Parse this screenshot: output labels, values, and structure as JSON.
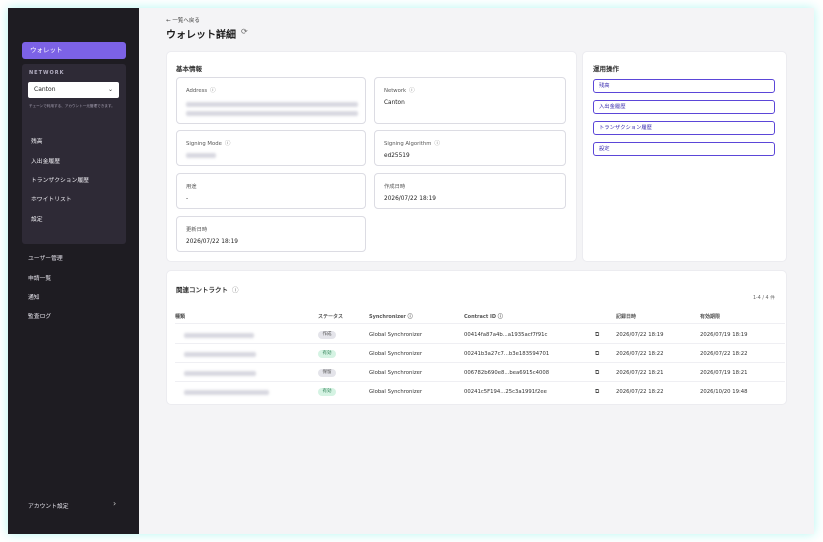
{
  "sidebar": {
    "active_item": "ウォレット",
    "network_label": "NETWORK",
    "network_value": "Canton",
    "network_hint": "チェーンで利用する、アカウント一元管理できます。",
    "network_items": [
      "残高",
      "入出金履歴",
      "トランザクション履歴",
      "ホワイトリスト",
      "設定"
    ],
    "links": [
      "ユーザー管理",
      "申請一覧",
      "通知",
      "監査ログ"
    ],
    "footer": "アカウント設定"
  },
  "main": {
    "back": "← 一覧へ戻る",
    "title": "ウォレット詳細",
    "basic_info": {
      "title": "基本情報",
      "address_label": "Address",
      "network_label": "Network",
      "network_value": "Canton",
      "signing_mode_label": "Signing Mode",
      "signing_algorithm_label": "Signing Algorithm",
      "signing_algorithm_value": "ed25519",
      "purpose_label": "用途",
      "purpose_value": "-",
      "created_label": "作成日時",
      "created_value": "2026/07/22 18:19",
      "updated_label": "更新日時",
      "updated_value": "2026/07/22 18:19"
    },
    "operations": {
      "title": "運用操作",
      "buttons": [
        "残高",
        "入出金履歴",
        "トランザクション履歴",
        "設定"
      ]
    },
    "contracts": {
      "title": "関連コントラクト",
      "count": "1-4 / 4 件",
      "headers": [
        "種類",
        "ステータス",
        "Synchronizer",
        "Contract ID",
        "",
        "記録日時",
        "有効期限"
      ],
      "rows": [
        {
          "status": "作成",
          "sync": "Global Synchronizer",
          "cid": "00414fa87a4b...a1935acf7f91c",
          "recorded": "2026/07/22 18:19",
          "expiry": "2026/07/19 18:19"
        },
        {
          "status": "有効",
          "sync": "Global Synchronizer",
          "cid": "00241b3a27c7...b3e183594701",
          "recorded": "2026/07/22 18:22",
          "expiry": "2026/07/22 18:22"
        },
        {
          "status": "保留",
          "sync": "Global Synchronizer",
          "cid": "006782b690e8...bea6915c4008",
          "recorded": "2026/07/22 18:21",
          "expiry": "2026/07/19 18:21"
        },
        {
          "status": "有効",
          "sync": "Global Synchronizer",
          "cid": "00241c5F194...25c3a1991f2ee",
          "recorded": "2026/07/22 18:22",
          "expiry": "2026/10/20 19:48"
        }
      ]
    }
  },
  "colors": {
    "accent": "#7c62e6",
    "sidebar_bg": "#1e1c22",
    "badge_green": "#d5f3e3",
    "badge_grey": "#e4e4ea"
  }
}
